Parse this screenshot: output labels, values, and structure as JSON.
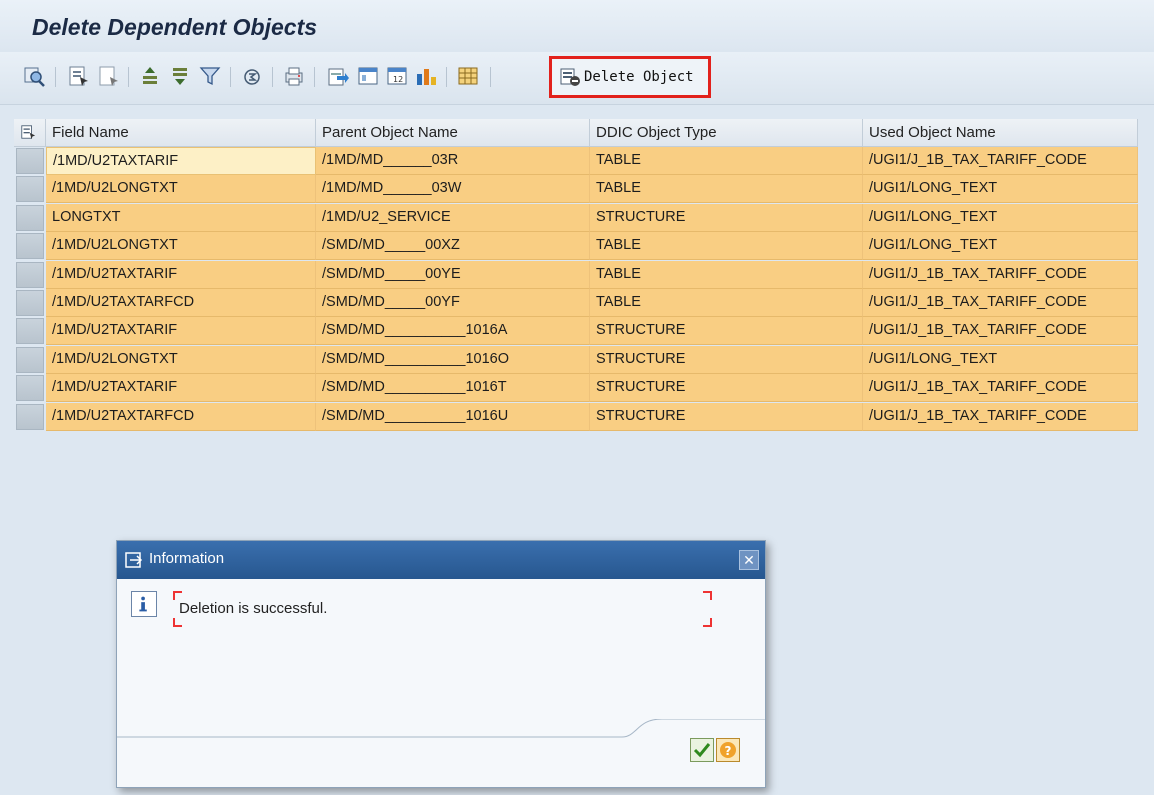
{
  "title": "Delete Dependent Objects",
  "toolbar": {
    "delete_label": "Delete Object"
  },
  "grid": {
    "columns": [
      "Field Name",
      "Parent Object Name",
      "DDIC Object Type",
      "Used Object Name"
    ],
    "rows": [
      {
        "field": "/1MD/U2TAXTARIF",
        "parent": "/1MD/MD______03R",
        "type": "TABLE",
        "used": "/UGI1/J_1B_TAX_TARIFF_CODE"
      },
      {
        "field": "/1MD/U2LONGTXT",
        "parent": "/1MD/MD______03W",
        "type": "TABLE",
        "used": "/UGI1/LONG_TEXT"
      },
      {
        "field": "LONGTXT",
        "parent": "/1MD/U2_SERVICE",
        "type": "STRUCTURE",
        "used": "/UGI1/LONG_TEXT"
      },
      {
        "field": "/1MD/U2LONGTXT",
        "parent": "/SMD/MD_____00XZ",
        "type": "TABLE",
        "used": "/UGI1/LONG_TEXT"
      },
      {
        "field": "/1MD/U2TAXTARIF",
        "parent": "/SMD/MD_____00YE",
        "type": "TABLE",
        "used": "/UGI1/J_1B_TAX_TARIFF_CODE"
      },
      {
        "field": "/1MD/U2TAXTARFCD",
        "parent": "/SMD/MD_____00YF",
        "type": "TABLE",
        "used": "/UGI1/J_1B_TAX_TARIFF_CODE"
      },
      {
        "field": "/1MD/U2TAXTARIF",
        "parent": "/SMD/MD__________1016A",
        "type": "STRUCTURE",
        "used": "/UGI1/J_1B_TAX_TARIFF_CODE"
      },
      {
        "field": "/1MD/U2LONGTXT",
        "parent": "/SMD/MD__________1016O",
        "type": "STRUCTURE",
        "used": "/UGI1/LONG_TEXT"
      },
      {
        "field": "/1MD/U2TAXTARIF",
        "parent": "/SMD/MD__________1016T",
        "type": "STRUCTURE",
        "used": "/UGI1/J_1B_TAX_TARIFF_CODE"
      },
      {
        "field": "/1MD/U2TAXTARFCD",
        "parent": "/SMD/MD__________1016U",
        "type": "STRUCTURE",
        "used": "/UGI1/J_1B_TAX_TARIFF_CODE"
      }
    ]
  },
  "dialog": {
    "title": "Information",
    "message": "Deletion is successful.",
    "close_glyph": "✕"
  },
  "colors": {
    "row_highlight": "#f9ce83",
    "dialog_header": "#27578f",
    "delete_outline": "#e2211c"
  }
}
